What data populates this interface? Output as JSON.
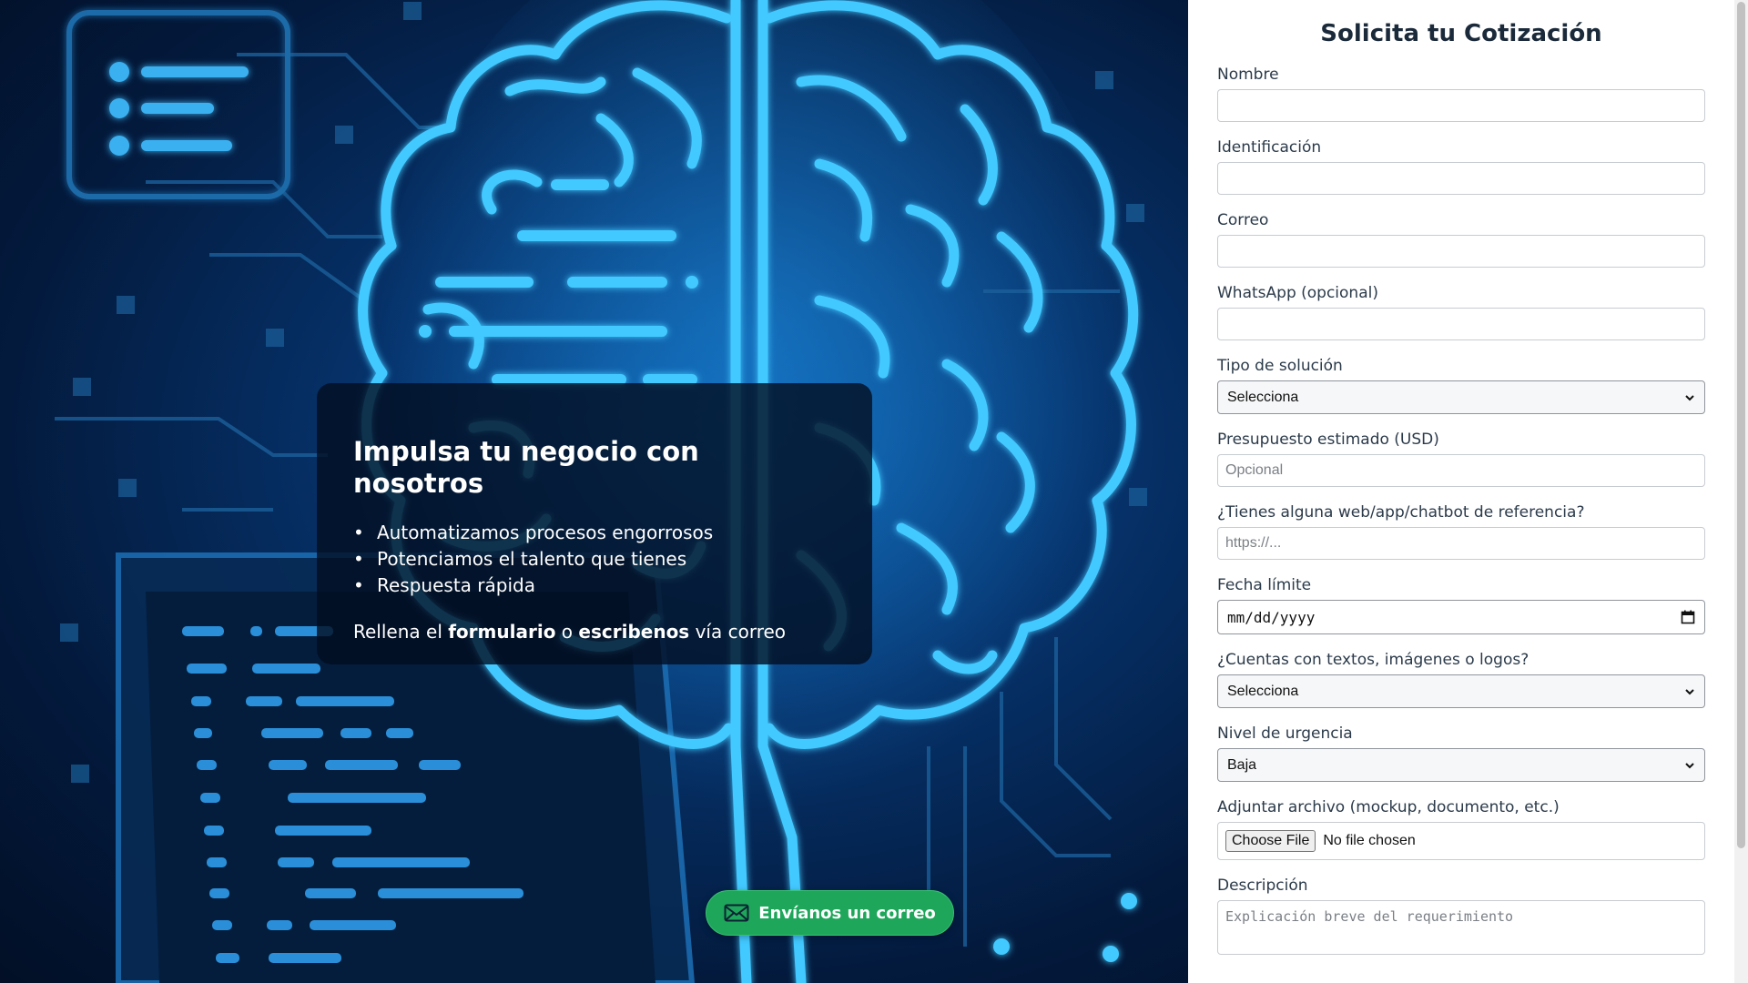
{
  "hero": {
    "heading": "Impulsa tu negocio con nosotros",
    "bullets": [
      "Automatizamos procesos engorrosos",
      "Potenciamos el talento que tienes",
      "Respuesta rápida"
    ],
    "cta_prefix": "Rellena el",
    "cta_form": "formulario",
    "cta_or": "o",
    "cta_write": "escribenos",
    "cta_suffix": "vía correo",
    "email_button": "Envíanos un correo"
  },
  "form": {
    "title": "Solicita tu Cotización",
    "fields": {
      "nombre": {
        "label": "Nombre",
        "value": ""
      },
      "identificacion": {
        "label": "Identificación",
        "value": ""
      },
      "correo": {
        "label": "Correo",
        "value": ""
      },
      "whatsapp": {
        "label": "WhatsApp (opcional)",
        "value": ""
      },
      "tipo_solucion": {
        "label": "Tipo de solución",
        "selected": "Selecciona"
      },
      "presupuesto": {
        "label": "Presupuesto estimado (USD)",
        "placeholder": "Opcional"
      },
      "referencia": {
        "label": "¿Tienes alguna web/app/chatbot de referencia?",
        "placeholder": "https://..."
      },
      "fecha": {
        "label": "Fecha límite",
        "value": "mm/dd/yyyy"
      },
      "contenido": {
        "label": "¿Cuentas con textos, imágenes o logos?",
        "selected": "Selecciona"
      },
      "urgencia": {
        "label": "Nivel de urgencia",
        "selected": "Baja"
      },
      "archivo": {
        "label": "Adjuntar archivo (mockup, documento, etc.)",
        "button": "Choose File",
        "status": "No file chosen"
      },
      "descripcion": {
        "label": "Descripción",
        "placeholder": "Explicación breve del requerimiento"
      }
    }
  },
  "colors": {
    "hero_bg": "#031a3d",
    "glow": "#3cc8ff",
    "button_green": "#1ea65a",
    "title_text": "#1b2a3a"
  },
  "icons": [
    "document-list-icon",
    "brain-illustration",
    "code-screen-illustration",
    "mail-icon",
    "calendar-icon",
    "chevron-down-icon"
  ]
}
